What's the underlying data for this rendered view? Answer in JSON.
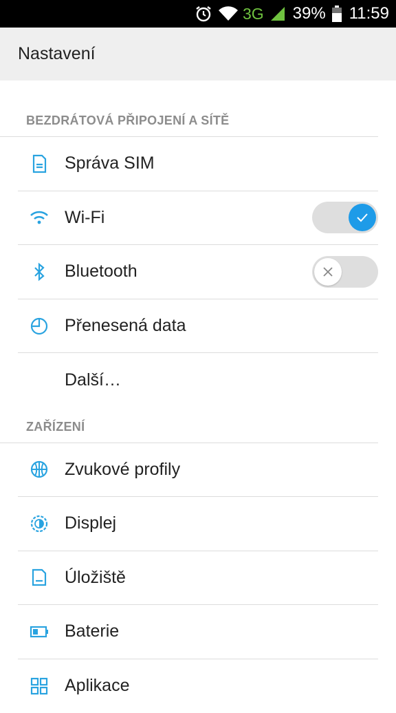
{
  "status_bar": {
    "network_type": "3G",
    "battery_percent": "39%",
    "time": "11:59",
    "icons": [
      "alarm-icon",
      "wifi-signal-icon",
      "cell-signal-icon",
      "battery-icon"
    ]
  },
  "app_bar": {
    "title": "Nastavení"
  },
  "sections": [
    {
      "header": "BEZDRÁTOVÁ PŘIPOJENÍ A SÍTĚ",
      "items": [
        {
          "label": "Správa SIM",
          "icon": "sim-card-icon"
        },
        {
          "label": "Wi-Fi",
          "icon": "wifi-icon",
          "toggle": "on"
        },
        {
          "label": "Bluetooth",
          "icon": "bluetooth-icon",
          "toggle": "off"
        },
        {
          "label": "Přenesená data",
          "icon": "data-usage-icon"
        },
        {
          "label": "Další…"
        }
      ]
    },
    {
      "header": "ZAŘÍZENÍ",
      "items": [
        {
          "label": "Zvukové profily",
          "icon": "audio-profiles-icon"
        },
        {
          "label": "Displej",
          "icon": "display-icon"
        },
        {
          "label": "Úložiště",
          "icon": "storage-icon"
        },
        {
          "label": "Baterie",
          "icon": "battery-setting-icon"
        },
        {
          "label": "Aplikace",
          "icon": "apps-icon"
        }
      ]
    }
  ],
  "colors": {
    "accent": "#1e9be8",
    "icon": "#29a3e0",
    "network_type": "#6fc23f",
    "section_header": "#8c8c8c",
    "app_bar_bg": "#efefef"
  }
}
